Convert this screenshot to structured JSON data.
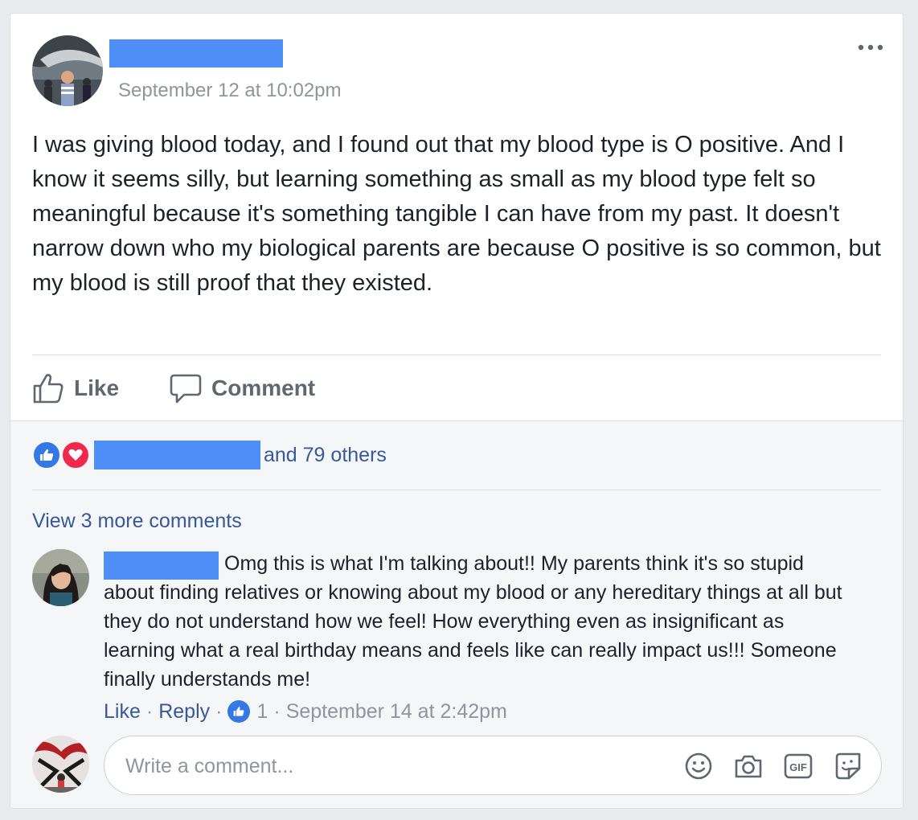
{
  "post": {
    "author_name": "",
    "timestamp": "September 12 at 10:02pm",
    "body": "I was giving blood today, and I found out that my blood type is O positive. And I know it seems silly, but learning something as small as my blood type felt so meaningful because it's something tangible I can have from my past. It doesn't narrow down who my biological parents are because O positive is so common, but my blood is still proof that they existed.",
    "more_icon": "ellipsis-icon"
  },
  "actions": {
    "like_label": "Like",
    "comment_label": "Comment"
  },
  "reactions": {
    "icons": [
      "like-reaction-icon",
      "love-reaction-icon"
    ],
    "others_text": "and 79 others",
    "colors": {
      "like": "#3578e5",
      "love": "#f0284a"
    }
  },
  "comments": {
    "view_more": "View 3 more comments",
    "items": [
      {
        "author_name": "",
        "text": "Omg this is what I'm talking about!! My parents think it's so stupid about finding relatives or knowing about my blood or any hereditary things at all but they do not understand how we feel! How everything even as insignificant as learning what a real birthday means and feels like can really impact us!!! Someone finally understands me!",
        "like_label": "Like",
        "reply_label": "Reply",
        "like_count": "1",
        "timestamp": "September 14 at 2:42pm"
      }
    ]
  },
  "composer": {
    "placeholder": "Write a comment...",
    "icons": [
      "emoji-icon",
      "camera-icon",
      "gif-icon",
      "sticker-icon"
    ],
    "gif_text": "GIF"
  },
  "colors": {
    "link": "#385898",
    "redaction": "#4e8ef7",
    "meta": "#90949c"
  }
}
